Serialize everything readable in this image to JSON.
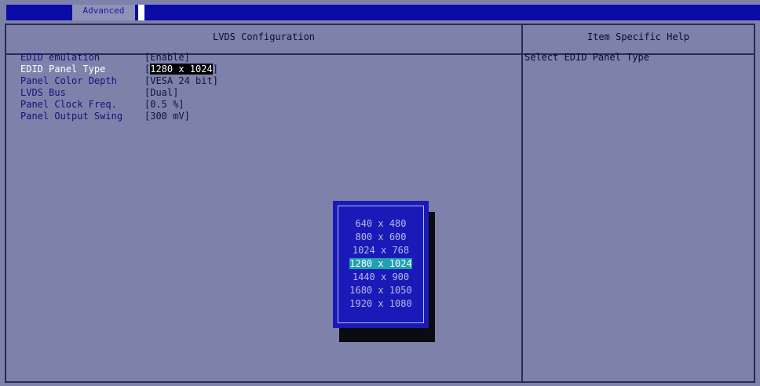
{
  "top_bar": {
    "tab_label": "Advanced"
  },
  "panel": {
    "title": "LVDS Configuration",
    "help_title": "Item Specific Help",
    "help_text": "Select EDID Panel Type"
  },
  "settings": [
    {
      "label": "EDID emulation",
      "value": "[Enable]"
    },
    {
      "label": "EDID Panel Type",
      "value_prefix": "[",
      "value_highlight": "1280 x 1024",
      "value_suffix": "]"
    },
    {
      "label": "Panel Color Depth",
      "value": "[VESA 24 bit]"
    },
    {
      "label": "LVDS Bus",
      "value": "[Dual]"
    },
    {
      "label": "Panel Clock Freq.",
      "value": "[0.5 %]"
    },
    {
      "label": "Panel Output Swing",
      "value": "[300 mV]"
    }
  ],
  "popup": {
    "options": [
      "640 x 480",
      "800 x 600",
      "1024 x 768",
      "1280 x 1024",
      "1440 x 900",
      "1680 x 1050",
      "1920 x 1080"
    ],
    "selected": "1280 x 1024"
  },
  "colors": {
    "background": "#7e82ab",
    "top_bar": "#0b0ba8",
    "popup": "#1a1ab8",
    "selection": "#20a0b0"
  }
}
